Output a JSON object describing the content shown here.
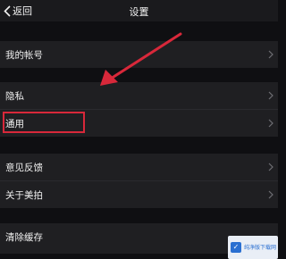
{
  "navbar": {
    "back_label": "返回",
    "title": "设置"
  },
  "settings": {
    "my_account": "我的帐号",
    "privacy": "隐私",
    "general": "通用",
    "feedback": "意见反馈",
    "about": "关于美拍",
    "clear_cache": "清除缓存"
  },
  "annotation": {
    "color": "#d8283a"
  },
  "watermark": {
    "text": "纯净版下载网"
  },
  "icons": [
    "chevron-left-icon",
    "chevron-right-icon",
    "red-arrow-icon"
  ]
}
